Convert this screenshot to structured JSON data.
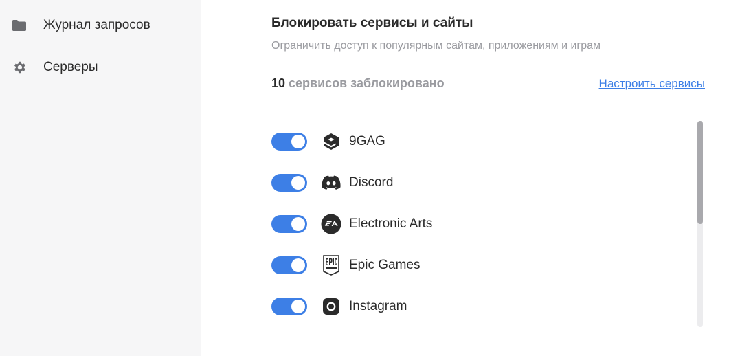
{
  "sidebar": {
    "items": [
      {
        "label": "Журнал запросов",
        "icon": "folder-icon"
      },
      {
        "label": "Серверы",
        "icon": "gear-icon"
      }
    ]
  },
  "main": {
    "title": "Блокировать сервисы и сайты",
    "subtitle": "Ограничить доступ к популярным сайтам, приложениям и играм",
    "blocked_count": "10",
    "blocked_text": " сервисов заблокировано",
    "configure_link": "Настроить сервисы",
    "services": [
      {
        "name": "9GAG",
        "icon": "9gag-icon",
        "enabled": true
      },
      {
        "name": "Discord",
        "icon": "discord-icon",
        "enabled": true
      },
      {
        "name": "Electronic Arts",
        "icon": "ea-icon",
        "enabled": true
      },
      {
        "name": "Epic Games",
        "icon": "epic-games-icon",
        "enabled": true
      },
      {
        "name": "Instagram",
        "icon": "instagram-icon",
        "enabled": true
      }
    ]
  },
  "colors": {
    "accent": "#3d7fe6",
    "sidebar_bg": "#f6f6f7",
    "muted_text": "#9a9ba0",
    "icon_dark": "#2b2b2b"
  }
}
